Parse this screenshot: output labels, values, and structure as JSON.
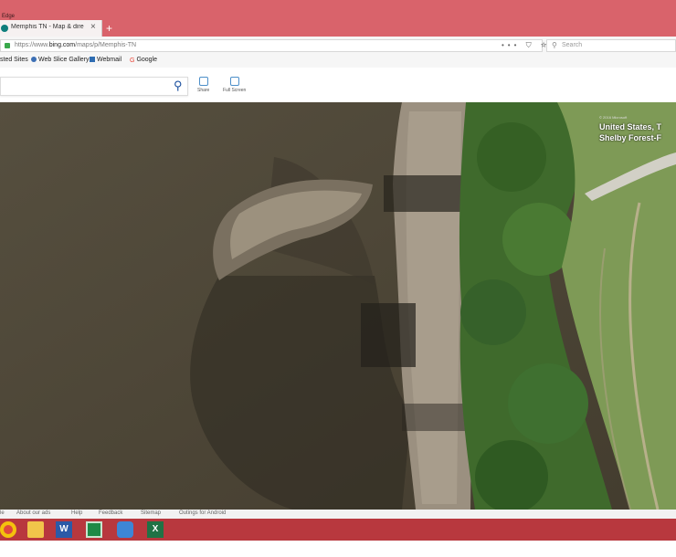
{
  "app": {
    "name": "Edge"
  },
  "tab": {
    "title": "Memphis TN - Map & directi",
    "close": "×",
    "new": "+"
  },
  "address": {
    "url_prefix": "https://www.",
    "url_domain": "bing.com",
    "url_path": "/maps/p/Memphis-TN",
    "icons": "••• ⛉ ☆",
    "search_placeholder": "Search"
  },
  "bookmarks": [
    {
      "label": "sted Sites",
      "color": "#4a86c5"
    },
    {
      "label": "Web Slice Gallery",
      "color": "#3c6fb4"
    },
    {
      "label": "Webmail",
      "color": "#2f6db2"
    },
    {
      "label": "Google",
      "color": "#ea4335"
    }
  ],
  "toolbar": {
    "share": "Share",
    "full_screen": "Full Screen"
  },
  "map": {
    "copyright": "© 2016 Microsoft",
    "location_line1": "United States, T",
    "location_line2": "Shelby Forest-F"
  },
  "footer": [
    "le",
    "About our ads",
    "Help",
    "Feedback",
    "Sitemap",
    "Outings for Android"
  ],
  "taskbar": [
    {
      "name": "chrome",
      "color": "#e0493c"
    },
    {
      "name": "file-explorer",
      "color": "#f1c54a"
    },
    {
      "name": "word",
      "color": "#2b5aa7"
    },
    {
      "name": "excel-sheet",
      "color": "#1f8a46"
    },
    {
      "name": "edge-browser",
      "color": "#3d86d6"
    },
    {
      "name": "excel",
      "color": "#207245"
    }
  ]
}
